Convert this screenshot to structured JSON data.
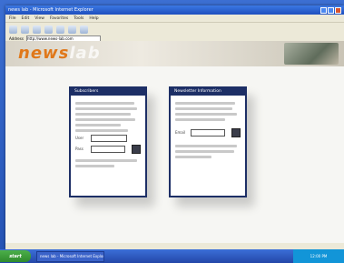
{
  "window": {
    "title": "news lab - Microsoft Internet Explorer",
    "menu": [
      "File",
      "Edit",
      "View",
      "Favorites",
      "Tools",
      "Help"
    ]
  },
  "toolbar": {
    "buttons": [
      "back-icon",
      "forward-icon",
      "stop-icon",
      "refresh-icon",
      "home-icon",
      "search-icon",
      "favorites-icon"
    ]
  },
  "address": {
    "label": "Address",
    "value": "http://www.news-lab.com"
  },
  "banner": {
    "logo_main": "news",
    "logo_secondary": "lab"
  },
  "panel_left": {
    "header": "Subscribers",
    "field1_label": "User",
    "field2_label": "Pass"
  },
  "panel_right": {
    "header": "Newsletter Information",
    "field1_label": "Email"
  },
  "taskbar": {
    "start_label": "start",
    "task_label": "news lab - Microsoft Internet Explorer",
    "tray_text": "12:00 PM"
  },
  "colors": {
    "accent": "#e0781a",
    "panel_header": "#1d2f66"
  }
}
